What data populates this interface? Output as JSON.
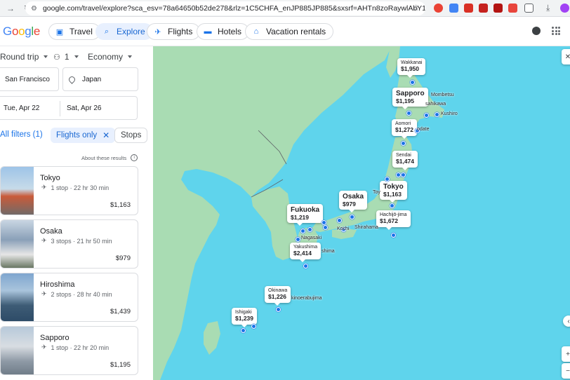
{
  "browser": {
    "url": "google.com/travel/explore?sca_esv=78a64650b52de278&rlz=1C5CHFA_enJP885JP885&sxsrf=AHTn8zoRaywlAbY1HBtAT0UM2..."
  },
  "header": {
    "logo": "Google",
    "tabs": [
      {
        "label": "Travel",
        "icon": "travel-bag-icon"
      },
      {
        "label": "Explore",
        "icon": "explore-icon"
      },
      {
        "label": "Flights",
        "icon": "airplane-icon"
      },
      {
        "label": "Hotels",
        "icon": "bed-icon"
      },
      {
        "label": "Vacation rentals",
        "icon": "house-icon"
      }
    ]
  },
  "search": {
    "trip_type": "Round trip",
    "passengers": "1",
    "cabin": "Economy",
    "origin": "San Francisco",
    "destination": "Japan",
    "depart": "Tue, Apr 22",
    "return": "Sat, Apr 26"
  },
  "filters": {
    "all_filters": "All filters (1)",
    "flights_only": "Flights only",
    "stops": "Stops",
    "about": "About these results"
  },
  "results": [
    {
      "city": "Tokyo",
      "stops": "1 stop · 22 hr 30 min",
      "price": "$1,163",
      "thumb_color": "#c95b3a"
    },
    {
      "city": "Osaka",
      "stops": "3 stops · 21 hr 50 min",
      "price": "$979",
      "thumb_color": "#7b8fa8"
    },
    {
      "city": "Hiroshima",
      "stops": "2 stops · 28 hr 40 min",
      "price": "$1,439",
      "thumb_color": "#4f6b8a"
    },
    {
      "city": "Sapporo",
      "stops": "1 stop · 22 hr 20 min",
      "price": "$1,195",
      "thumb_color": "#8f9aa6"
    }
  ],
  "map": {
    "destinations": [
      {
        "name": "Wakkanai",
        "price": "$1,950",
        "big": false
      },
      {
        "name": "Sapporo",
        "price": "$1,195",
        "big": true
      },
      {
        "name": "Aomori",
        "price": "$1,272",
        "big": false
      },
      {
        "name": "Sendai",
        "price": "$1,474",
        "big": false
      },
      {
        "name": "Tokyo",
        "price": "$1,163",
        "big": true
      },
      {
        "name": "Hachijō-jima",
        "price": "$1,672",
        "big": false
      },
      {
        "name": "Osaka",
        "price": "$979",
        "big": true
      },
      {
        "name": "Fukuoka",
        "price": "$1,219",
        "big": true
      },
      {
        "name": "Yakushima",
        "price": "$2,414",
        "big": false
      },
      {
        "name": "Okinawa",
        "price": "$1,226",
        "big": false
      },
      {
        "name": "Ishigaki",
        "price": "$1,239",
        "big": false
      }
    ],
    "labels": [
      "Mombetsu",
      "sahikawa",
      "Kushiro",
      "odate",
      "Toy",
      "Kochi",
      "Shirahama",
      "Nagasaki",
      "shima",
      "kinoerabujima"
    ]
  }
}
